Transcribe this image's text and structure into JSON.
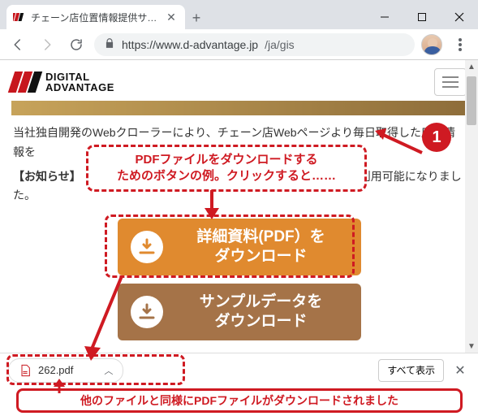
{
  "window": {
    "tab_title": "チェーン店位置情報提供サービス（G",
    "minimize_aria": "minimize",
    "maximize_aria": "maximize",
    "close_aria": "close"
  },
  "toolbar": {
    "url_host": "https://www.d-advantage.jp",
    "url_path": "/ja/gis"
  },
  "page": {
    "logo_line1": "DIGITAL",
    "logo_line2": "ADVANTAGE",
    "para1": "当社独自開発のWebクローラーにより、チェーン店Webページより毎日取得した店舗情報を",
    "notice_label": "【お知らせ】",
    "notice_tail": "利用可能になりました。",
    "btn1_line1": "詳細資料(PDF）を",
    "btn1_line2": "ダウンロード",
    "btn2_line1": "サンプルデータを",
    "btn2_line2": "ダウンロード"
  },
  "downloads": {
    "item_filename": "262.pdf",
    "show_all": "すべて表示"
  },
  "annotations": {
    "badge1": "1",
    "callout1_line1": "PDFファイルをダウンロードする",
    "callout1_line2": "ためのボタンの例。クリックすると……",
    "callout2": "他のファイルと同様にPDFファイルがダウンロードされました"
  }
}
